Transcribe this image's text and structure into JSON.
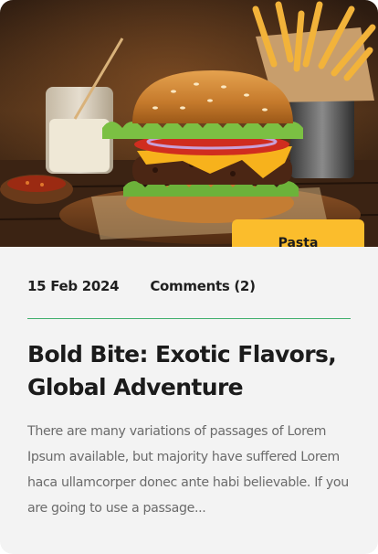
{
  "post": {
    "image_alt": "Burger with fries, sauce and a drink on a wooden table",
    "category": "Pasta",
    "date": "15 Feb 2024",
    "comments": "Comments (2)",
    "title": "Bold Bite: Exotic Flavors, Global Adventure",
    "excerpt": "There are many variations of passages of Lorem Ipsum available, but majority have suffered Lorem haca ullamcorper donec ante habi believable. If you are going to use a passage..."
  },
  "colors": {
    "card_bg": "#f3f3f3",
    "tag_bg": "#fbbd2c",
    "divider": "#3fae6b",
    "title": "#1b1b1b",
    "excerpt": "#6b6b6b"
  }
}
